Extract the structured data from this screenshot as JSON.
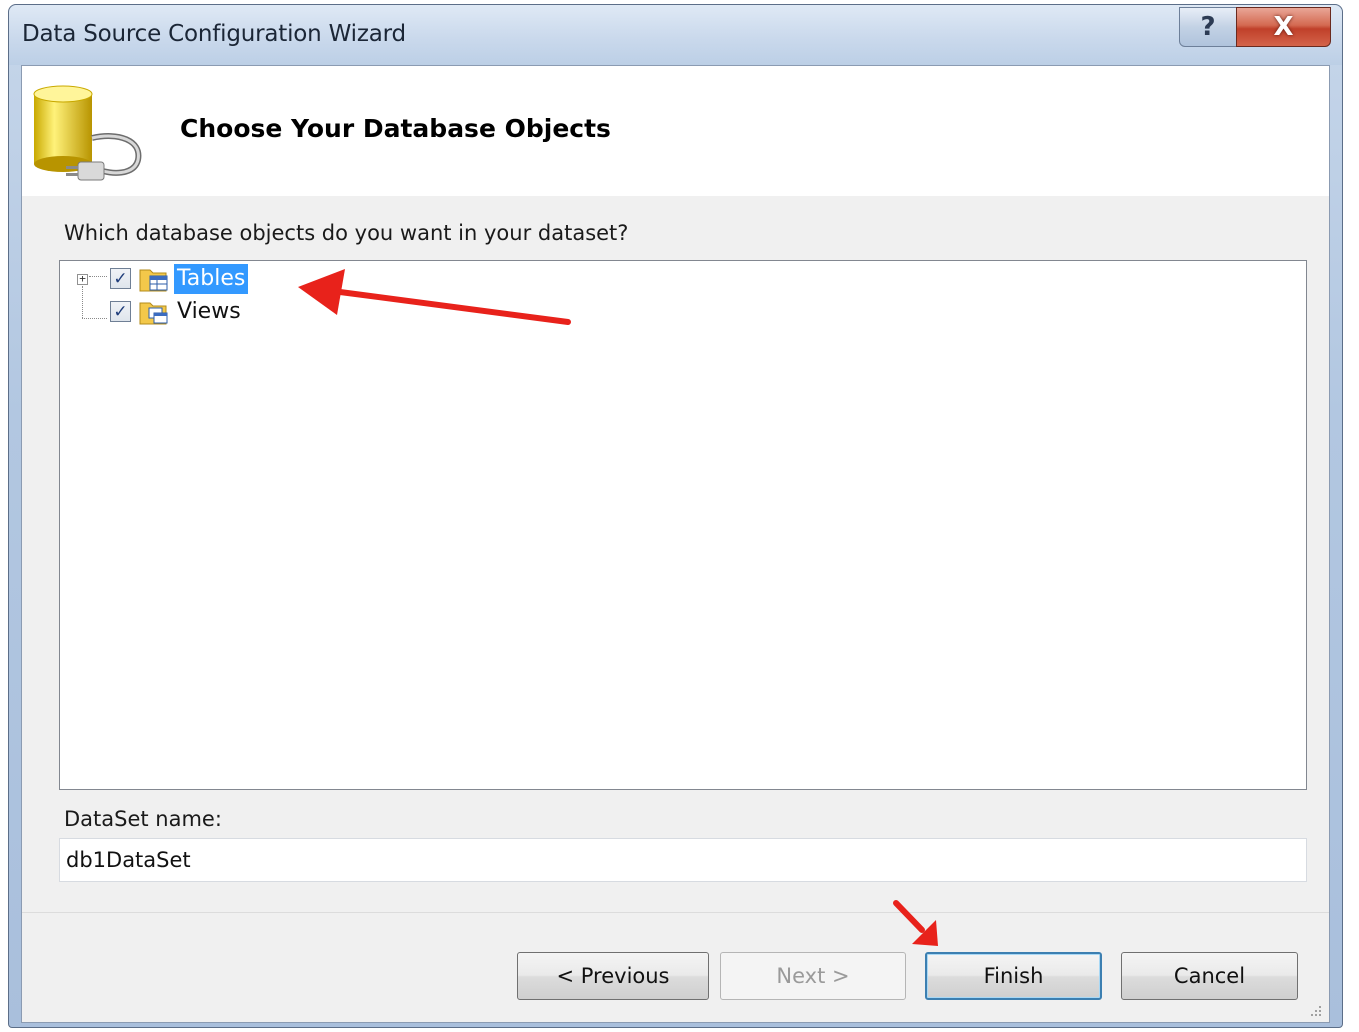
{
  "window": {
    "title": "Data Source Configuration Wizard",
    "help_label": "?",
    "close_label": "X"
  },
  "header": {
    "title": "Choose Your Database Objects",
    "icon": "database-plug-icon"
  },
  "prompt": "Which database objects do you want in your dataset?",
  "tree": {
    "items": [
      {
        "label": "Tables",
        "checked": true,
        "expandable": true,
        "selected": true,
        "icon": "tables-folder-icon"
      },
      {
        "label": "Views",
        "checked": true,
        "expandable": false,
        "selected": false,
        "icon": "views-folder-icon"
      }
    ]
  },
  "dataset": {
    "label": "DataSet name:",
    "value": "db1DataSet"
  },
  "buttons": {
    "previous": "< Previous",
    "next": "Next >",
    "finish": "Finish",
    "cancel": "Cancel"
  },
  "colors": {
    "selection": "#3399ff",
    "annotation_arrow": "#e8221b",
    "close_button": "#c9452f"
  }
}
